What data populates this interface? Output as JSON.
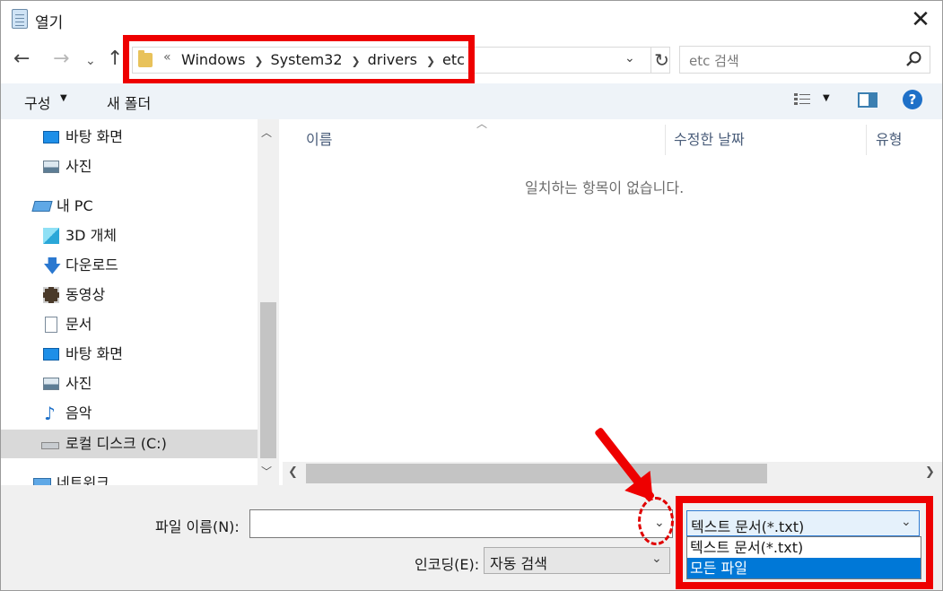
{
  "window": {
    "title": "열기"
  },
  "address": {
    "overflow_chevron": "«",
    "crumbs": [
      "Windows",
      "System32",
      "drivers",
      "etc"
    ]
  },
  "search": {
    "placeholder": "etc 검색"
  },
  "toolbar": {
    "organize": "구성",
    "new_folder": "새 폴더",
    "help": "?"
  },
  "nav": {
    "items": [
      {
        "label": "바탕 화면",
        "icon": "desktop-icon"
      },
      {
        "label": "사진",
        "icon": "pictures-icon"
      },
      {
        "label": "내 PC",
        "icon": "this-pc-icon"
      },
      {
        "label": "3D 개체",
        "icon": "3d-objects-icon"
      },
      {
        "label": "다운로드",
        "icon": "download-icon"
      },
      {
        "label": "동영상",
        "icon": "videos-icon"
      },
      {
        "label": "문서",
        "icon": "documents-icon"
      },
      {
        "label": "바탕 화면",
        "icon": "desktop-icon"
      },
      {
        "label": "사진",
        "icon": "pictures-icon"
      },
      {
        "label": "음악",
        "icon": "music-icon"
      },
      {
        "label": "로컬 디스크 (C:)",
        "icon": "local-disk-icon",
        "selected": true
      },
      {
        "label": "네트워크",
        "icon": "network-icon"
      }
    ]
  },
  "columns": {
    "name": "이름",
    "date_modified": "수정한 날짜",
    "type": "유형"
  },
  "content": {
    "empty_message": "일치하는 항목이 없습니다."
  },
  "bottom": {
    "filename_label": "파일 이름(N):",
    "filename_value": "",
    "encoding_label": "인코딩(E):",
    "encoding_value": "자동 검색",
    "filetype_selected": "텍스트 문서(*.txt)",
    "filetype_options": [
      "텍스트 문서(*.txt)",
      "모든 파일"
    ],
    "filetype_highlighted_index": 1
  },
  "colors": {
    "annotation_red": "#ee0000",
    "selection_blue": "#0078d7",
    "accent": "#1e70c8"
  }
}
